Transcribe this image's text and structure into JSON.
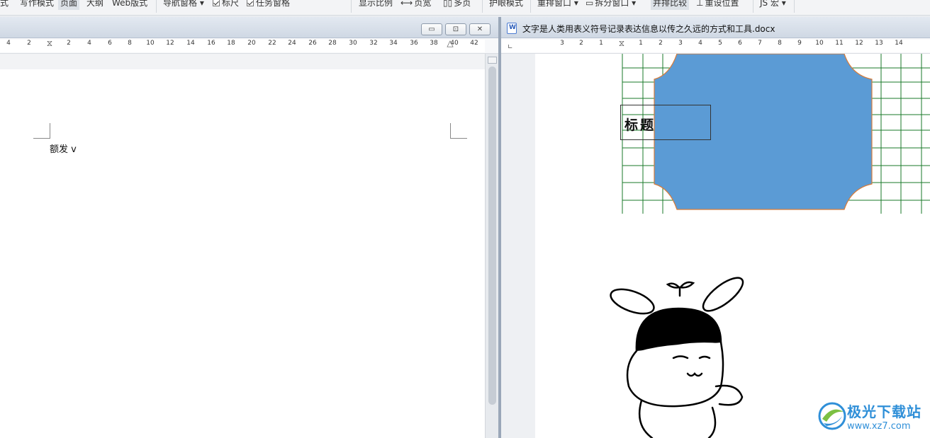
{
  "ribbon": {
    "items": [
      "式",
      "写作模式",
      "页面",
      "大纲",
      "Web版式",
      "导航窗格",
      "标尺",
      "任务窗格",
      "显示比例",
      "页宽",
      "多页",
      "护眼模式",
      "重排窗口",
      "拆分窗口",
      "并排比较",
      "重设位置",
      "JS 宏"
    ]
  },
  "left_pane": {
    "ruler_ticks": [
      "4",
      "2",
      "2",
      "4",
      "6",
      "8",
      "10",
      "12",
      "14",
      "16",
      "18",
      "20",
      "22",
      "24",
      "26",
      "28",
      "30",
      "32",
      "34",
      "36",
      "38",
      "40",
      "42"
    ],
    "body_text": "额发 v",
    "window_buttons": [
      "minimize",
      "restore",
      "close"
    ]
  },
  "right_pane": {
    "title": "文字是人类用表义符号记录表达信息以传之久远的方式和工具.docx",
    "ruler_ticks": [
      "3",
      "2",
      "1",
      "1",
      "2",
      "3",
      "4",
      "5",
      "6",
      "7",
      "8",
      "9",
      "10",
      "11",
      "12",
      "13",
      "14"
    ],
    "textbox_label": "标题",
    "shape_fill": "#5b9bd5",
    "shape_outline": "#d77c3a",
    "grid_color": "#1a7a28"
  },
  "watermark": {
    "text": "极光下载站",
    "url": "www.xz7.com"
  }
}
